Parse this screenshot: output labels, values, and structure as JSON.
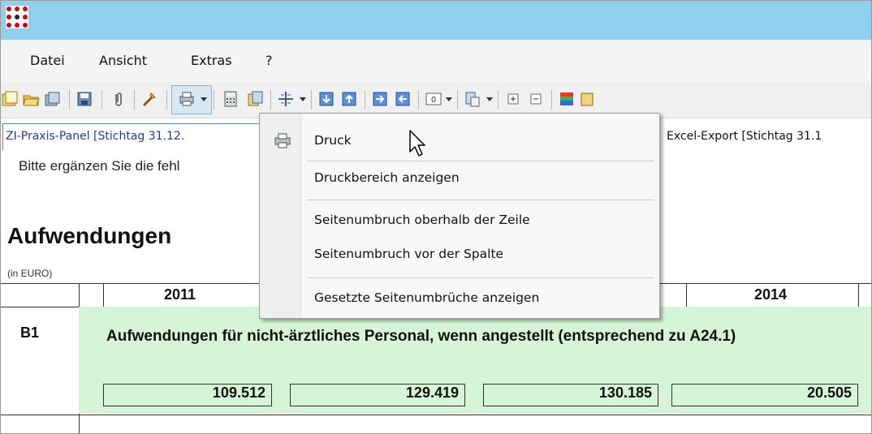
{
  "menu": {
    "items": [
      "Datei",
      "Ansicht",
      "Extras",
      "?"
    ]
  },
  "tabs": {
    "active_label": "ZI-Praxis-Panel [Stichtag 31.12.",
    "other_label": "Excel-Export [Stichtag 31.1"
  },
  "content": {
    "hint": "Bitte ergänzen Sie die fehl",
    "section_title": "Aufwendungen",
    "unit": "(in EURO)",
    "years": [
      "2011",
      "2014"
    ],
    "row": {
      "code": "B1",
      "text": "Aufwendungen für nicht-ärztliches Personal, wenn angestellt (entsprechend zu A24.1)",
      "values": [
        "109.512",
        "129.419",
        "130.185",
        "20.505"
      ]
    }
  },
  "dropdown": {
    "items": [
      "Druck",
      "Druckbereich anzeigen",
      "Seitenumbruch oberhalb der Zeile",
      "Seitenumbruch vor der Spalte",
      "Gesetzte Seitenumbrüche anzeigen"
    ]
  },
  "colors": {
    "title_bar": "#8fd0ec",
    "row_green": "#d6f5d6",
    "tab_link": "#1b3f9a"
  }
}
